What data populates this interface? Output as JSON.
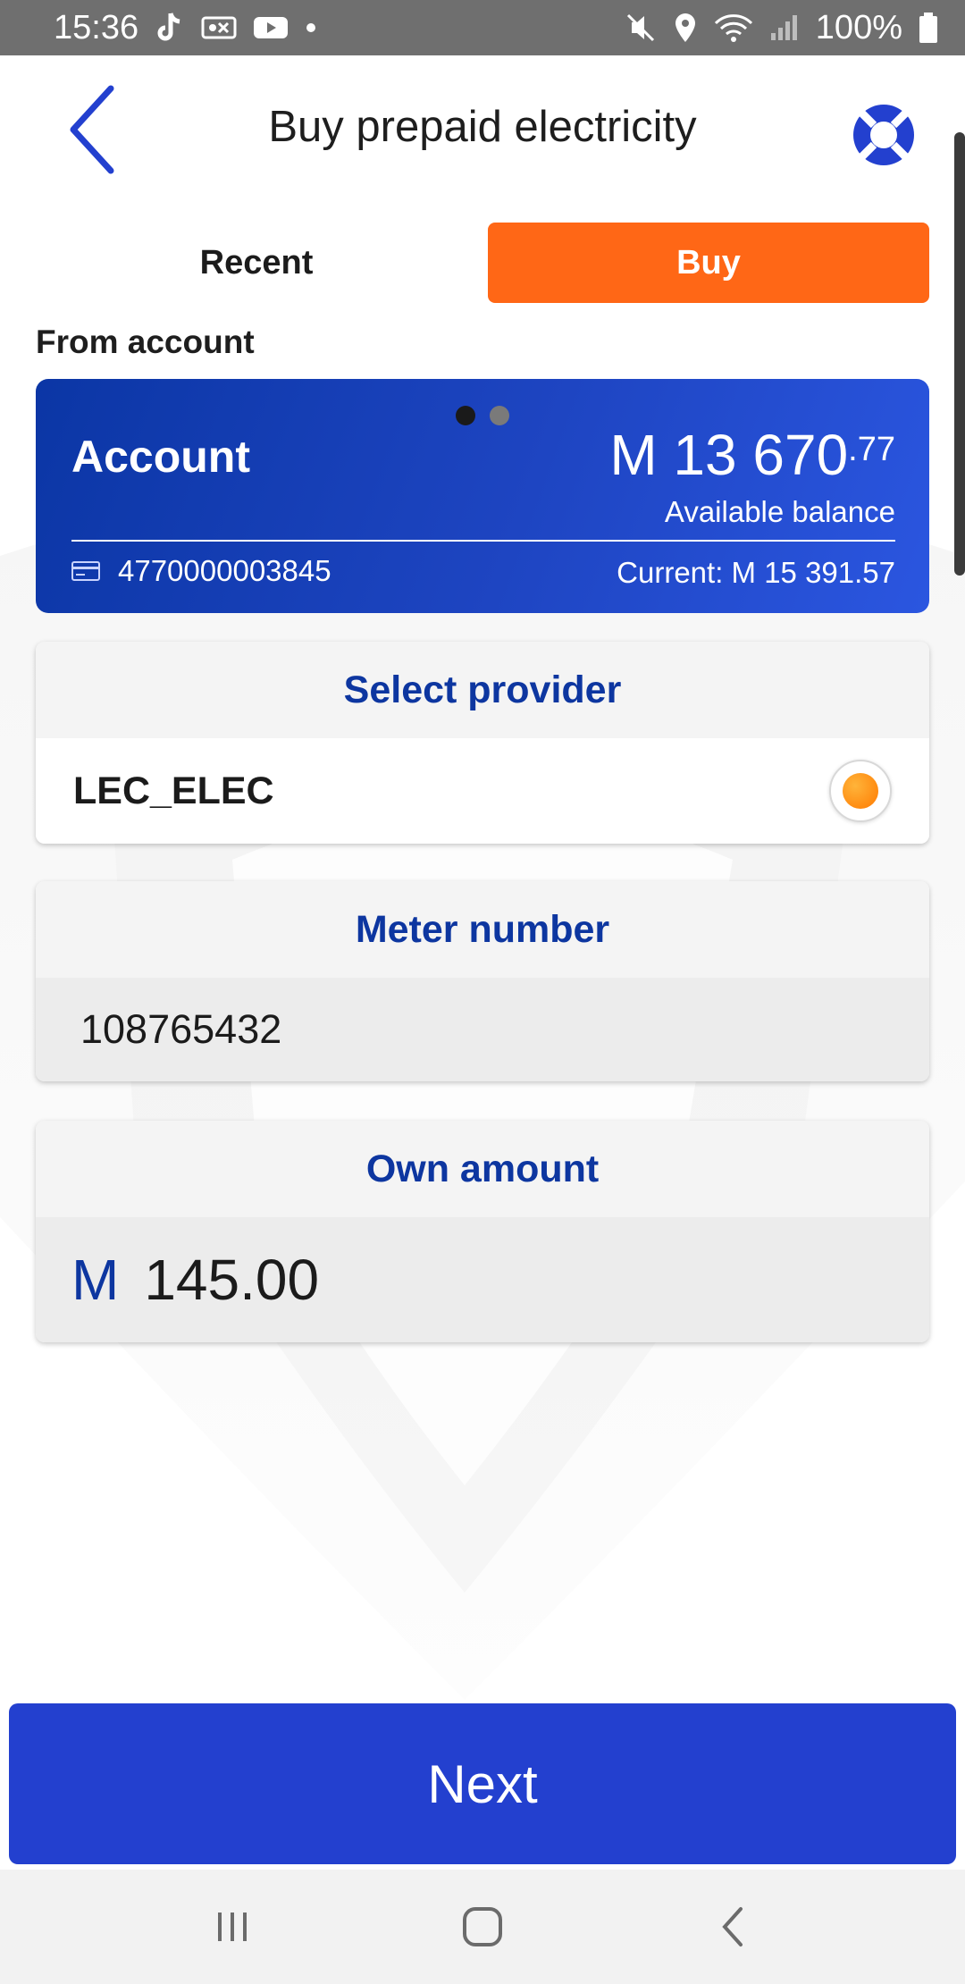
{
  "status_bar": {
    "time": "15:36",
    "battery": "100%",
    "left_icons": [
      "tiktok-icon",
      "voicemail-icon",
      "youtube-icon",
      "dot-icon"
    ],
    "right_icons": [
      "mute-icon",
      "location-icon",
      "wifi-icon",
      "signal-icon",
      "battery-icon"
    ]
  },
  "header": {
    "title": "Buy prepaid electricity",
    "back_icon": "chevron-left-icon",
    "help_icon": "lifebuoy-icon"
  },
  "tabs": [
    {
      "label": "Recent",
      "active": false
    },
    {
      "label": "Buy",
      "active": true
    }
  ],
  "from_account": {
    "label": "From account",
    "account_name": "Account",
    "balance_main": "M 13 670",
    "balance_cents": ".77",
    "balance_caption": "Available balance",
    "account_number": "4770000003845",
    "current_balance": "Current: M 15 391.57",
    "pager": {
      "count": 2,
      "active_index": 0
    }
  },
  "provider": {
    "heading": "Select provider",
    "name": "LEC_ELEC",
    "selected": true
  },
  "meter": {
    "heading": "Meter number",
    "value": "108765432"
  },
  "amount": {
    "heading": "Own amount",
    "currency": "M",
    "value": "145.00"
  },
  "next_button": {
    "label": "Next"
  },
  "nav_bar": [
    "recents-icon",
    "home-icon",
    "back-icon"
  ],
  "colors": {
    "accent_orange": "#ff6716",
    "primary_blue": "#2340cf",
    "heading_blue": "#0d36a0",
    "status_bar": "#6f6f6f"
  }
}
